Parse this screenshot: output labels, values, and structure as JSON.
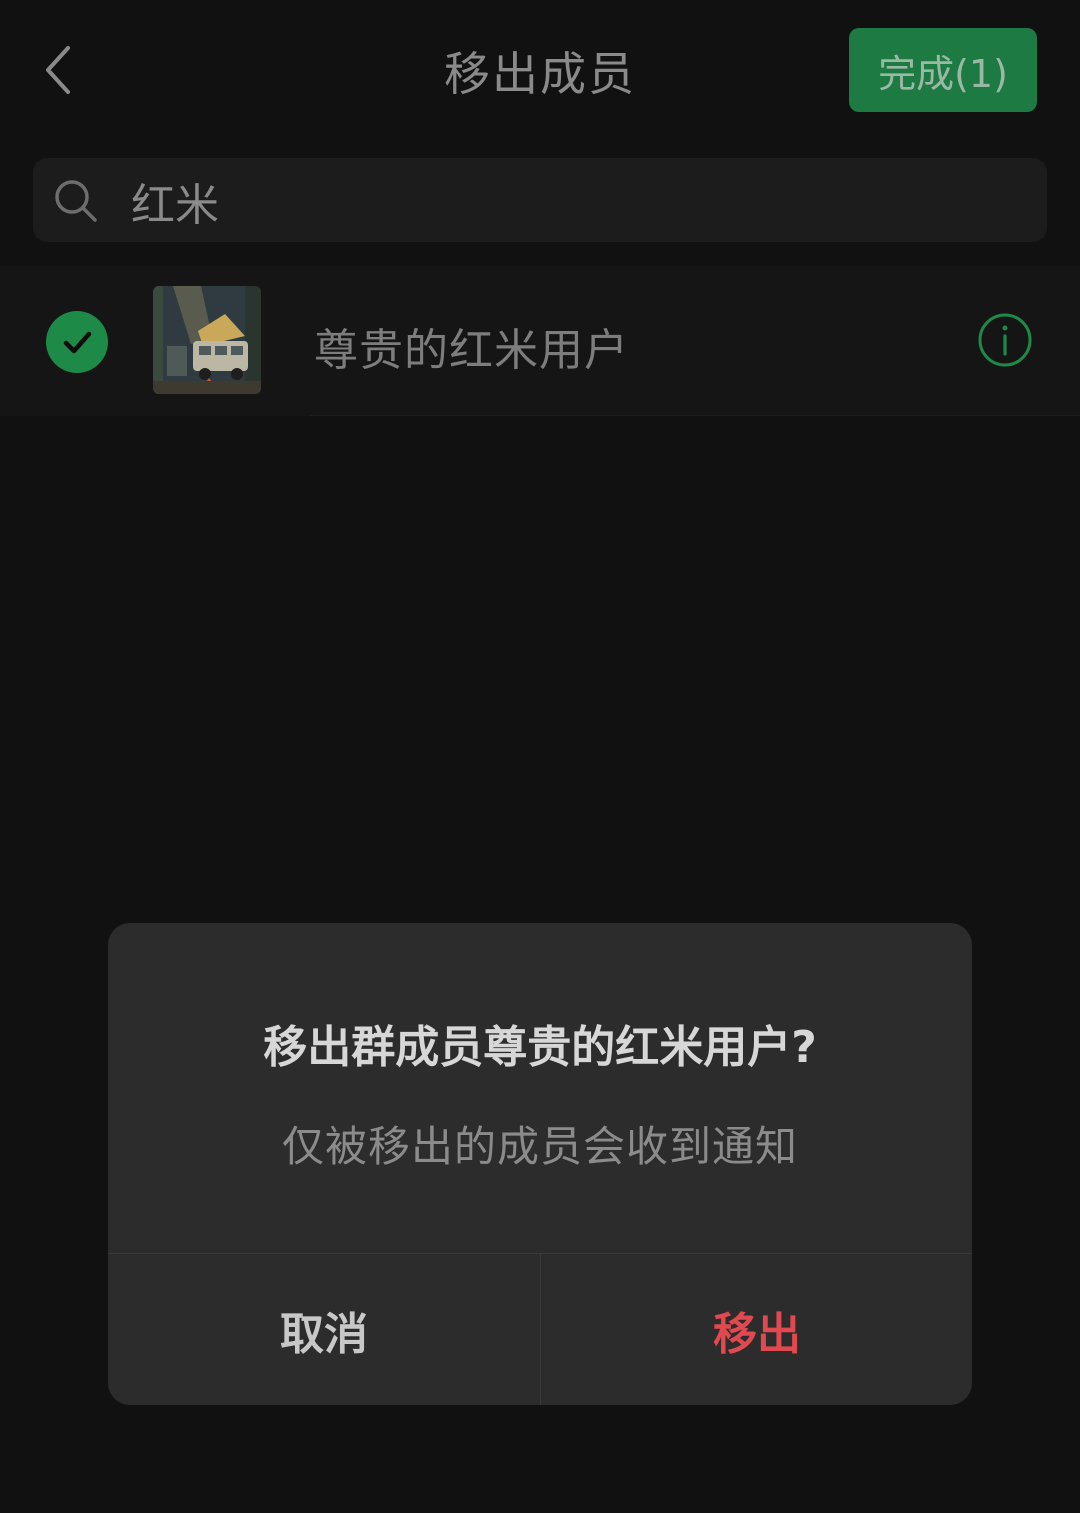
{
  "header": {
    "title": "移出成员",
    "done_label": "完成(1)"
  },
  "search": {
    "value": "红米"
  },
  "members": [
    {
      "name": "尊贵的红米用户",
      "selected": true
    }
  ],
  "dialog": {
    "title": "移出群成员尊贵的红米用户?",
    "message": "仅被移出的成员会收到通知",
    "cancel_label": "取消",
    "confirm_label": "移出"
  },
  "colors": {
    "accent_green": "#1d8a48",
    "danger_red": "#e0494f"
  },
  "icons": {
    "back": "chevron-left-icon",
    "search": "search-icon",
    "check": "check-circle-icon",
    "info": "info-icon"
  }
}
